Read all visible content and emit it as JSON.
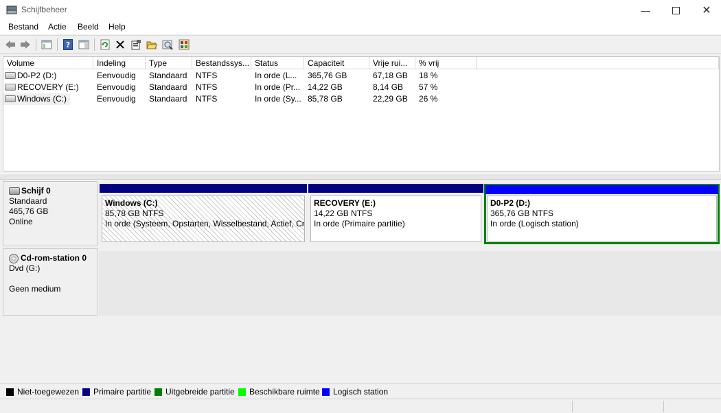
{
  "window": {
    "title": "Schijfbeheer",
    "icon": "disk-management-icon"
  },
  "menu": [
    "Bestand",
    "Actie",
    "Beeld",
    "Help"
  ],
  "toolbar": {
    "icons": [
      "back-arrow-icon",
      "forward-arrow-icon",
      "console-tree-icon",
      "help-icon",
      "properties-pane-icon",
      "refresh-icon",
      "delete-icon",
      "properties-icon",
      "open-icon",
      "explore-icon",
      "settings-icon"
    ]
  },
  "volume_list": {
    "columns": [
      "Volume",
      "Indeling",
      "Type",
      "Bestandssys...",
      "Status",
      "Capaciteit",
      "Vrije rui...",
      "% vrij"
    ],
    "rows": [
      [
        "D0-P2 (D:)",
        "Eenvoudig",
        "Standaard",
        "NTFS",
        "In orde (L...",
        "365,76 GB",
        "67,18 GB",
        "18 %"
      ],
      [
        "RECOVERY (E:)",
        "Eenvoudig",
        "Standaard",
        "NTFS",
        "In orde (Pr...",
        "14,22 GB",
        "8,14 GB",
        "57 %"
      ],
      [
        "Windows (C:)",
        "Eenvoudig",
        "Standaard",
        "NTFS",
        "In orde (Sy...",
        "85,78 GB",
        "22,29 GB",
        "26 %"
      ]
    ]
  },
  "disks": [
    {
      "name": "Schijf 0",
      "type": "Standaard",
      "size": "465,76 GB",
      "status": "Online",
      "partitions": [
        {
          "name": "Windows  (C:)",
          "size": "85,78 GB NTFS",
          "status": "In orde (Systeem, Opstarten, Wisselbestand, Actief, Cra",
          "bar_color": "#000080",
          "selected": false
        },
        {
          "name": "RECOVERY  (E:)",
          "size": "14,22 GB NTFS",
          "status": "In orde (Primaire partitie)",
          "bar_color": "#000080",
          "selected": false
        },
        {
          "name": "D0-P2  (D:)",
          "size": "365,76 GB NTFS",
          "status": "In orde (Logisch station)",
          "bar_color": "#0000ff",
          "selected": true
        }
      ]
    },
    {
      "name": "Cd-rom-station 0",
      "type": "Dvd (G:)",
      "status": "Geen medium"
    }
  ],
  "legend": [
    {
      "label": "Niet-toegewezen",
      "color": "#000000"
    },
    {
      "label": "Primaire partitie",
      "color": "#000080"
    },
    {
      "label": "Uitgebreide partitie",
      "color": "#008000"
    },
    {
      "label": "Beschikbare ruimte",
      "color": "#00ff00"
    },
    {
      "label": "Logisch station",
      "color": "#0000ff"
    }
  ]
}
